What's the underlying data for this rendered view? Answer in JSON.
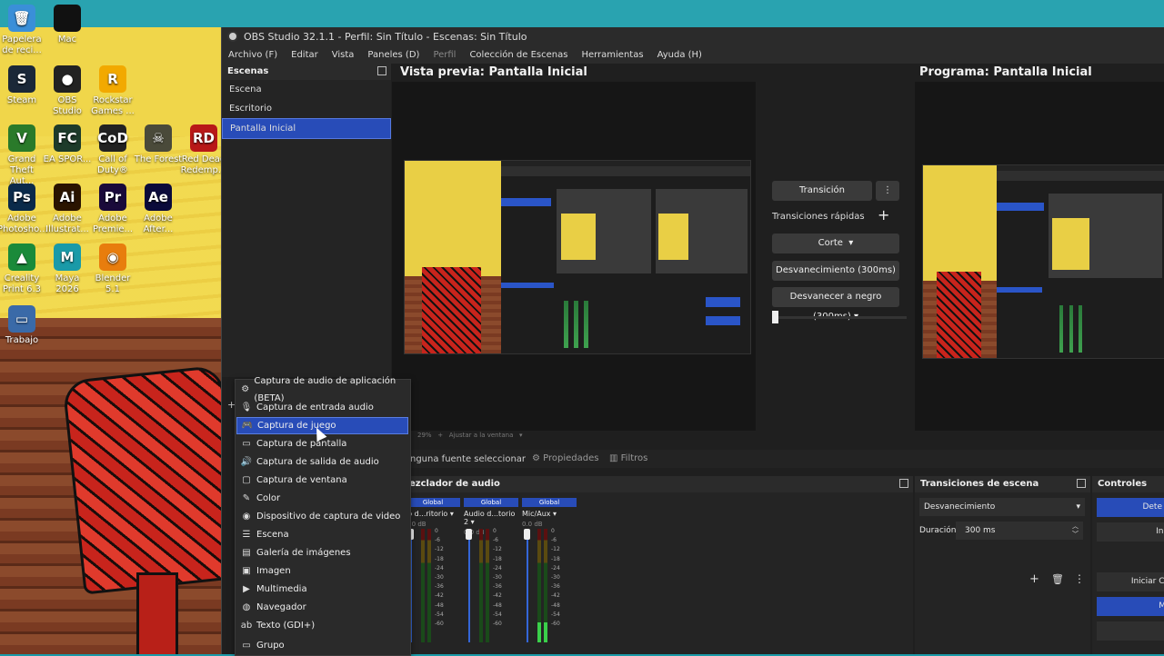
{
  "desktop": {
    "icons": [
      {
        "label": "Papelera de reci...",
        "glyph": "🗑",
        "color": "#3a8fd8"
      },
      {
        "label": "Mac",
        "glyph": "",
        "color": "#111111"
      },
      {
        "label": "Steam",
        "glyph": "S",
        "color": "#1b2838"
      },
      {
        "label": "OBS Studio",
        "glyph": "●",
        "color": "#222222"
      },
      {
        "label": "Rockstar Games ...",
        "glyph": "R",
        "color": "#f2a900"
      },
      {
        "label": "Grand Theft Aut...",
        "glyph": "V",
        "color": "#2a7a2a"
      },
      {
        "label": "EA SPOR...",
        "glyph": "FC",
        "color": "#1d3b2a"
      },
      {
        "label": "Call of Duty®",
        "glyph": "CoD",
        "color": "#222222"
      },
      {
        "label": "The Forest",
        "glyph": "☠",
        "color": "#4a4a3a"
      },
      {
        "label": "Red Dead Redemp...",
        "glyph": "RD",
        "color": "#b81818"
      },
      {
        "label": "Adobe Photosho...",
        "glyph": "Ps",
        "color": "#0a2a4a"
      },
      {
        "label": "Adobe Illustrat...",
        "glyph": "Ai",
        "color": "#2a1400"
      },
      {
        "label": "Adobe Premie...",
        "glyph": "Pr",
        "color": "#1a0a3a"
      },
      {
        "label": "Adobe After...",
        "glyph": "Ae",
        "color": "#0a0a3a"
      },
      {
        "label": "Creality Print 6.3",
        "glyph": "▲",
        "color": "#1a8a3a"
      },
      {
        "label": "Maya 2026",
        "glyph": "M",
        "color": "#1a9aa8"
      },
      {
        "label": "Blender 5.1",
        "glyph": "◉",
        "color": "#e87d0d"
      },
      {
        "label": "Trabajo",
        "glyph": "▭",
        "color": "#3a6aa8"
      }
    ]
  },
  "window": {
    "title": "OBS Studio 32.1.1 - Perfil: Sin Título - Escenas: Sin Título",
    "menu": [
      "Archivo (F)",
      "Editar",
      "Vista",
      "Paneles (D)",
      "Perfil",
      "Colección de Escenas",
      "Herramientas",
      "Ayuda (H)"
    ]
  },
  "scenes": {
    "header": "Escenas",
    "items": [
      "Escena",
      "Escritorio",
      "Pantalla Inicial"
    ],
    "selected_index": 2
  },
  "preview": {
    "title": "Vista previa: Pantalla Inicial"
  },
  "program": {
    "title": "Programa: Pantalla Inicial"
  },
  "transitions": {
    "transition_button": "Transición",
    "quick_label": "Transiciones rápidas",
    "items": [
      "Corte",
      "Desvanecimiento (300ms)",
      "Desvanecer a negro (300ms)"
    ]
  },
  "zoom_bar": {
    "zoom": "29%",
    "fit": "Ajustar a la ventana"
  },
  "source_bar": {
    "no_source": "nguna fuente seleccionar",
    "properties": "Propiedades",
    "filters": "Filtros"
  },
  "mixer": {
    "header": "ezclador de audio",
    "channels": [
      {
        "badge": "Global",
        "name": "io d...ritorio",
        "db": "0.0 dB"
      },
      {
        "badge": "Global",
        "name": "Audio d...torio 2",
        "db": "0.0 dB"
      },
      {
        "badge": "Global",
        "name": "Mic/Aux",
        "db": "0.0 dB"
      }
    ],
    "scale": [
      "0",
      "-6",
      "-12",
      "-18",
      "-24",
      "-30",
      "-36",
      "-42",
      "-48",
      "-54",
      "-60"
    ]
  },
  "scene_transitions": {
    "header": "Transiciones de escena",
    "type": "Desvanecimiento",
    "duration_label": "Duración",
    "duration_value": "300 ms"
  },
  "controls": {
    "header": "Controles",
    "buttons": [
      "Dete",
      "Ini",
      "Iniciar Ca",
      "M",
      ""
    ]
  },
  "context_menu": {
    "items": [
      {
        "label": "Captura de audio de aplicación (BETA)",
        "icon": "gear-icon",
        "glyph": "⚙"
      },
      {
        "label": "Captura de entrada audio",
        "icon": "microphone-icon",
        "glyph": "🎙"
      },
      {
        "label": "Captura de juego",
        "icon": "gamepad-icon",
        "glyph": "🎮"
      },
      {
        "label": "Captura de pantalla",
        "icon": "monitor-icon",
        "glyph": "▭"
      },
      {
        "label": "Captura de salida de audio",
        "icon": "speaker-icon",
        "glyph": "🔊"
      },
      {
        "label": "Captura de ventana",
        "icon": "window-icon",
        "glyph": "▢"
      },
      {
        "label": "Color",
        "icon": "brush-icon",
        "glyph": "✎"
      },
      {
        "label": "Dispositivo de captura de video",
        "icon": "camera-icon",
        "glyph": "◉"
      },
      {
        "label": "Escena",
        "icon": "list-icon",
        "glyph": "☰"
      },
      {
        "label": "Galería de imágenes",
        "icon": "gallery-icon",
        "glyph": "▤"
      },
      {
        "label": "Imagen",
        "icon": "image-icon",
        "glyph": "▣"
      },
      {
        "label": "Multimedia",
        "icon": "play-icon",
        "glyph": "▶"
      },
      {
        "label": "Navegador",
        "icon": "globe-icon",
        "glyph": "◍"
      },
      {
        "label": "Texto (GDI+)",
        "icon": "text-icon",
        "glyph": "ab"
      },
      {
        "label": "Grupo",
        "icon": "folder-icon",
        "glyph": "▭"
      }
    ],
    "selected_index": 2
  }
}
